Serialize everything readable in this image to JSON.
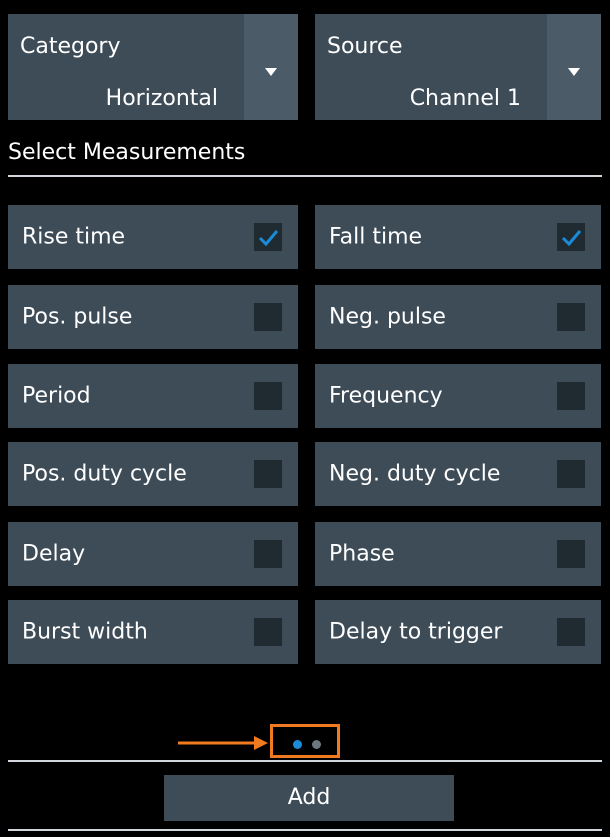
{
  "category": {
    "label": "Category",
    "value": "Horizontal"
  },
  "source": {
    "label": "Source",
    "value": "Channel 1"
  },
  "section_title": "Select Measurements",
  "measurements": [
    {
      "label": "Rise time",
      "checked": true
    },
    {
      "label": "Fall time",
      "checked": true
    },
    {
      "label": "Pos. pulse",
      "checked": false
    },
    {
      "label": "Neg. pulse",
      "checked": false
    },
    {
      "label": "Period",
      "checked": false
    },
    {
      "label": "Frequency",
      "checked": false
    },
    {
      "label": "Pos. duty cycle",
      "checked": false
    },
    {
      "label": "Neg. duty cycle",
      "checked": false
    },
    {
      "label": "Delay",
      "checked": false
    },
    {
      "label": "Phase",
      "checked": false
    },
    {
      "label": "Burst width",
      "checked": false
    },
    {
      "label": "Delay to trigger",
      "checked": false
    }
  ],
  "pagination": {
    "pages": 2,
    "current": 1
  },
  "add_label": "Add",
  "colors": {
    "accent": "#1a8bd8",
    "highlight": "#f07a20"
  }
}
